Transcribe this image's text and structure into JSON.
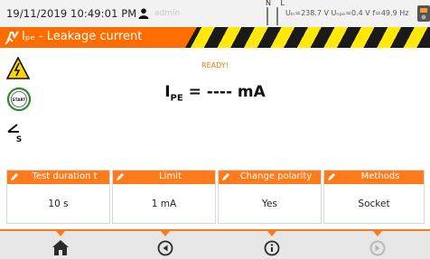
{
  "status_bar": {
    "datetime": "19/11/2019 10:49:01 PM",
    "user": "admin",
    "phase_labels": "N L",
    "measurements": "Uₗₙ=238.7 V Uₙₚₑ=0.4 V f=49.9 Hz"
  },
  "header": {
    "title": "Iₚₑ - Leakage current",
    "accent_color": "#ff6d00",
    "stripe_colors": [
      "#1a1a1a",
      "#ffe80a"
    ]
  },
  "main": {
    "status": "READY!",
    "reading_symbol": "I",
    "reading_sub": "PE",
    "reading_value": " = ---- mA"
  },
  "icons": [
    "high-voltage-icon",
    "start-icon",
    "probe-s-icon"
  ],
  "params": [
    {
      "label": "Test duration t",
      "value": "10 s"
    },
    {
      "label": "Limit",
      "value": "1 mA"
    },
    {
      "label": "Change polarity",
      "value": "Yes"
    },
    {
      "label": "Methods",
      "value": "Socket"
    }
  ],
  "bottom_nav": [
    "home-icon",
    "back-icon",
    "info-icon",
    "forward-icon"
  ]
}
